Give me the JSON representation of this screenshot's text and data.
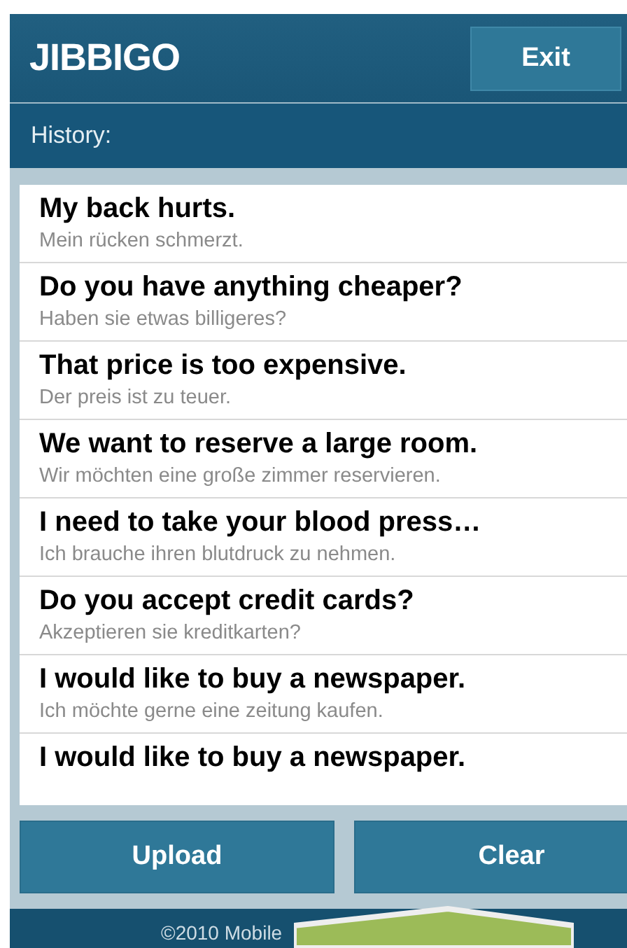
{
  "header": {
    "logo": "JIBBIGO",
    "exit_button": "Exit"
  },
  "history_label": "History:",
  "history": [
    {
      "phrase": "My back hurts.",
      "translation": "Mein rücken schmerzt."
    },
    {
      "phrase": "Do you have anything cheaper?",
      "translation": "Haben sie etwas billigeres?"
    },
    {
      "phrase": "That price is too expensive.",
      "translation": "Der preis ist zu teuer."
    },
    {
      "phrase": "We want to reserve a large room.",
      "translation": "Wir möchten eine große zimmer reservieren."
    },
    {
      "phrase": "I need to take your blood press…",
      "translation": "Ich brauche ihren blutdruck zu nehmen."
    },
    {
      "phrase": "Do you accept credit cards?",
      "translation": "Akzeptieren sie kreditkarten?"
    },
    {
      "phrase": "I would like to buy a newspaper.",
      "translation": "Ich möchte gerne eine zeitung kaufen."
    },
    {
      "phrase": "I would like to buy a newspaper."
    }
  ],
  "buttons": [
    "Upload",
    "Clear"
  ],
  "footer": "©2010 Mobile"
}
